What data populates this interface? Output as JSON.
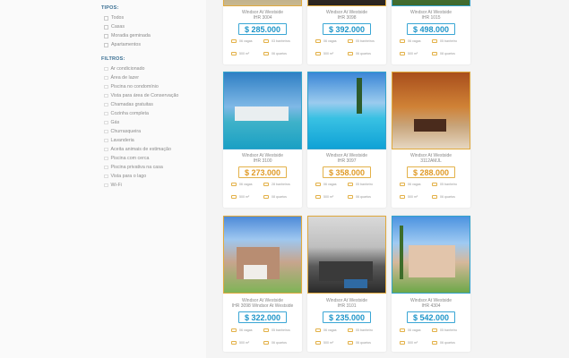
{
  "sidebar": {
    "types_title": "TIPOS:",
    "types": [
      "Todos",
      "Casas",
      "Moradia geminada",
      "Apartamentos"
    ],
    "filters_title": "FILTROS:",
    "filters": [
      "Ar condicionado",
      "Área de lazer",
      "Piscina no condomínio",
      "Vista para área de Conservação",
      "Chamadas gratuitas",
      "Cozinha completa",
      "Gás",
      "Churrasqueira",
      "Lavanderia",
      "Aceita animais de estimação",
      "Piscina com cerca",
      "Piscina privativa na casa",
      "Vista para o lago",
      "Wi-Fi"
    ]
  },
  "cards": [
    {
      "name": "Windsor At Westside",
      "code": "IHR 3004",
      "price": "$ 285.000",
      "vagas": "06 vagas",
      "banheiros": "03 banheiros",
      "area": "500 m²",
      "quartos": "06 quartos"
    },
    {
      "name": "Windsor At Westside",
      "code": "IHR 3098",
      "price": "$ 392.000",
      "vagas": "06 vagas",
      "banheiros": "05 banheiros",
      "area": "500 m²",
      "quartos": "06 quartos"
    },
    {
      "name": "Windsor At Westside",
      "code": "IHR 1015",
      "price": "$ 498.000",
      "vagas": "06 vagas",
      "banheiros": "05 banheiro",
      "area": "500 m²",
      "quartos": "08 quartos"
    },
    {
      "name": "Windsor At Westside",
      "code": "IHR 3100",
      "price": "$ 273.000",
      "vagas": "06 vagas",
      "banheiros": "28 banheiros",
      "area": "500 m²",
      "quartos": "08 quartos"
    },
    {
      "name": "Windsor At Westside",
      "code": "IHR 3097",
      "price": "$ 358.000",
      "vagas": "06 vagas",
      "banheiros": "05 banheiro",
      "area": "500 m²",
      "quartos": "06 quartos"
    },
    {
      "name": "Windsor At Westside",
      "code": "3112AMJL",
      "price": "$ 288.000",
      "vagas": "06 vagas",
      "banheiros": "05 banheiro",
      "area": "500 m²",
      "quartos": "06 quartos"
    },
    {
      "name": "Windsor At Westside",
      "code": "IHR 3098 Windsor At Westside",
      "price": "$ 322.000",
      "vagas": "06 vagas",
      "banheiros": "05 banheiros",
      "area": "500 m²",
      "quartos": "06 quartos"
    },
    {
      "name": "Windsor At Westside",
      "code": "IHR 3101",
      "price": "$ 235.000",
      "vagas": "06 vagas",
      "banheiros": "05 banheiro",
      "area": "500 m²",
      "quartos": "06 quartos"
    },
    {
      "name": "Windsor At Westside",
      "code": "IHR 4304",
      "price": "$ 542.000",
      "vagas": "06 vagas",
      "banheiros": "05 banheiro",
      "area": "500 m²",
      "quartos": "06 quartos"
    }
  ]
}
